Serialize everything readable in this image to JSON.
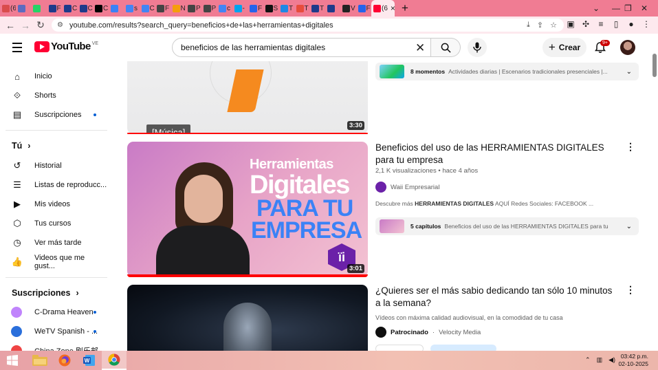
{
  "browser": {
    "tabs": [
      {
        "label": "(6",
        "color": "#d94c4c"
      },
      {
        "label": "",
        "color": "#5c6bc0"
      },
      {
        "label": "",
        "color": "#25d366"
      },
      {
        "label": "F",
        "color": "#1e3a8a"
      },
      {
        "label": "C",
        "color": "#1e3a8a"
      },
      {
        "label": "C",
        "color": "#1e3a8a"
      },
      {
        "label": "C",
        "color": "#000000"
      },
      {
        "label": "",
        "color": "#3b82f6"
      },
      {
        "label": "s",
        "color": "#4285f4"
      },
      {
        "label": "C",
        "color": "#4285f4"
      },
      {
        "label": "F",
        "color": "#444444"
      },
      {
        "label": "N",
        "color": "#f59e0b"
      },
      {
        "label": "P",
        "color": "#444444"
      },
      {
        "label": "P",
        "color": "#444444"
      },
      {
        "label": "c",
        "color": "#4285f4"
      },
      {
        "label": "-",
        "color": "#00a4ef"
      },
      {
        "label": "F",
        "color": "#2563eb"
      },
      {
        "label": "S",
        "color": "#111111"
      },
      {
        "label": "T",
        "color": "#1e88e5"
      },
      {
        "label": "T",
        "color": "#e74c3c"
      },
      {
        "label": "T",
        "color": "#1e3a8a"
      },
      {
        "label": "",
        "color": "#1e3a8a"
      },
      {
        "label": "V",
        "color": "#222222"
      },
      {
        "label": "F",
        "color": "#2563eb"
      }
    ],
    "active_tab": {
      "label": "(6",
      "color": "#ff0033"
    },
    "url": "youtube.com/results?search_query=beneficios+de+las+herramientas+digitales"
  },
  "header": {
    "logo_text": "YouTube",
    "country_code": "VE",
    "search_value": "beneficios de las herramientas digitales",
    "create_label": "Crear",
    "notif_count": "9+"
  },
  "sidebar": {
    "main": [
      {
        "label": "Inicio",
        "icon": "home-icon",
        "glyph": "⌂"
      },
      {
        "label": "Shorts",
        "icon": "shorts-icon",
        "glyph": "⟐"
      },
      {
        "label": "Suscripciones",
        "icon": "subscriptions-icon",
        "glyph": "▤"
      }
    ],
    "you_heading": "Tú",
    "you": [
      {
        "label": "Historial",
        "icon": "history-icon",
        "glyph": "↺"
      },
      {
        "label": "Listas de reproducc...",
        "icon": "playlists-icon",
        "glyph": "☰"
      },
      {
        "label": "Mis videos",
        "icon": "my-videos-icon",
        "glyph": "▶"
      },
      {
        "label": "Tus cursos",
        "icon": "courses-icon",
        "glyph": "⬡"
      },
      {
        "label": "Ver más tarde",
        "icon": "watch-later-icon",
        "glyph": "◷"
      },
      {
        "label": "Videos que me gust...",
        "icon": "liked-videos-icon",
        "glyph": "👍"
      }
    ],
    "subs_heading": "Suscripciones",
    "subs": [
      {
        "label": "C-Drama Heaven",
        "color": "#c084fc"
      },
      {
        "label": "WeTV Spanish - ...",
        "color": "#2a6fdb"
      },
      {
        "label": "China Zone 剧乐部",
        "color": "#ef4444"
      }
    ]
  },
  "results": [
    {
      "duration": "3:30",
      "caption": "[Música]",
      "chapters_count": "8 momentos",
      "chapters_text": "Actividades diarias | Escenarios tradicionales presenciales |..."
    },
    {
      "title": "Beneficios del uso de las HERRAMIENTAS DIGITALES para tu empresa",
      "views": "2,1 K visualizaciones",
      "age": "hace 4 años",
      "channel": "Waii Empresarial",
      "description_prefix": "Descubre más ",
      "description_bold": "HERRAMIENTAS DIGITALES",
      "description_suffix": " AQUÍ Redes Sociales: FACEBOOK ...",
      "duration": "3:01",
      "thumb_lines": [
        "Herramientas",
        "Digitales",
        "PARA TU",
        "EMPRESA"
      ],
      "thumb_badge": "ïi",
      "chapters_count": "5 capítulos",
      "chapters_text": "Beneficios del uso de las HERRAMIENTAS DIGITALES para tu ..."
    },
    {
      "title": "¿Quieres ser el más sabio dedicando tan sólo 10 minutos a la semana?",
      "description": "Vídeos con máxima calidad audiovisual, en la comodidad de tu casa",
      "sponsored": "Patrocinado",
      "advertiser": "Velocity Media"
    }
  ],
  "taskbar": {
    "time": "03:42 p.m.",
    "date": "02-10-2025"
  }
}
